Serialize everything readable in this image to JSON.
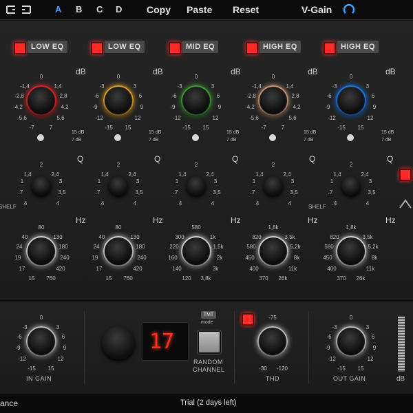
{
  "topbar": {
    "undo_icon": "undo-icon",
    "redo_icon": "redo-icon",
    "slots": [
      "A",
      "B",
      "C",
      "D"
    ],
    "active_slot": "A",
    "copy": "Copy",
    "paste": "Paste",
    "reset": "Reset",
    "vgain": "V-Gain",
    "vgain_icon": "power-icon"
  },
  "bands": [
    {
      "label": "LOW EQ",
      "color": "#e02424"
    },
    {
      "label": "LOW EQ",
      "color": "#e0a020"
    },
    {
      "label": "MID EQ",
      "color": "#3aa030"
    },
    {
      "label": "HIGH EQ",
      "color": "#c89a78"
    },
    {
      "label": "HIGH EQ",
      "color": "#1a78e8"
    }
  ],
  "gain_scales": [
    {
      "unit": "dB",
      "t": "0",
      "l1": "-1,4",
      "r1": "1,4",
      "l2": "-2,8",
      "r2": "2,8",
      "l3": "-4,2",
      "r3": "4,2",
      "l4": "-5,6",
      "r4": "5,6",
      "bl": "-7",
      "br": "7"
    },
    {
      "unit": "dB",
      "t": "0",
      "l1": "-3",
      "r1": "3",
      "l2": "-6",
      "r2": "6",
      "l3": "-9",
      "r3": "9",
      "l4": "-12",
      "r4": "12",
      "bl": "-15",
      "br": "15"
    },
    {
      "unit": "dB",
      "t": "0",
      "l1": "-3",
      "r1": "3",
      "l2": "-6",
      "r2": "6",
      "l3": "-9",
      "r3": "9",
      "l4": "-12",
      "r4": "12",
      "bl": "-15",
      "br": "15"
    },
    {
      "unit": "dB",
      "t": "0",
      "l1": "-1,4",
      "r1": "1,4",
      "l2": "-2,8",
      "r2": "2,8",
      "l3": "-4,2",
      "r3": "4,2",
      "l4": "-5,6",
      "r4": "5,6",
      "bl": "-7",
      "br": "7"
    },
    {
      "unit": "dB",
      "t": "0",
      "l1": "-3",
      "r1": "3",
      "l2": "-6",
      "r2": "6",
      "l3": "-9",
      "r3": "9",
      "l4": "-12",
      "r4": "12",
      "bl": "-15",
      "br": "15"
    }
  ],
  "range_switch": {
    "hi": "15 dB",
    "lo": "7 dB"
  },
  "q_scales": [
    {
      "unit": "Q",
      "t": "2",
      "l1": "1,4",
      "r1": "2,4",
      "l2": "1",
      "r2": "3",
      "l3": ".7",
      "r3": "3,5",
      "l4": ".4",
      "r4": "4",
      "extra": "SHELF"
    },
    {
      "unit": "Q",
      "t": "2",
      "l1": "1,4",
      "r1": "2,4",
      "l2": "1",
      "r2": "3",
      "l3": ".7",
      "r3": "3,5",
      "l4": ".4",
      "r4": "4",
      "extra": ""
    },
    {
      "unit": "Q",
      "t": "2",
      "l1": "1,4",
      "r1": "2,4",
      "l2": "1",
      "r2": "3",
      "l3": ".7",
      "r3": "3,5",
      "l4": ".4",
      "r4": "4",
      "extra": ""
    },
    {
      "unit": "Q",
      "t": "2",
      "l1": "1,4",
      "r1": "2,4",
      "l2": "1",
      "r2": "3",
      "l3": ".7",
      "r3": "3,5",
      "l4": ".4",
      "r4": "4",
      "extra": ""
    },
    {
      "unit": "Q",
      "t": "2",
      "l1": "1,4",
      "r1": "2,4",
      "l2": "1",
      "r2": "3",
      "l3": ".7",
      "r3": "3,5",
      "l4": ".4",
      "r4": "4",
      "extra": "SHELF"
    }
  ],
  "hz_scales": [
    {
      "unit": "Hz",
      "t": "80",
      "l1": "40",
      "r1": "130",
      "l2": "24",
      "r2": "180",
      "l3": "19",
      "r3": "240",
      "l4": "17",
      "r4": "420",
      "bl": "15",
      "br": "760"
    },
    {
      "unit": "Hz",
      "t": "80",
      "l1": "40",
      "r1": "130",
      "l2": "24",
      "r2": "180",
      "l3": "19",
      "r3": "240",
      "l4": "17",
      "r4": "420",
      "bl": "15",
      "br": "760"
    },
    {
      "unit": "Hz",
      "t": "580",
      "l1": "300",
      "r1": "1k",
      "l2": "220",
      "r2": "1,5k",
      "l3": "160",
      "r3": "2k",
      "l4": "140",
      "r4": "3k",
      "bl": "120",
      "br": "3,8k"
    },
    {
      "unit": "Hz",
      "t": "1,8k",
      "l1": "820",
      "r1": "3,5k",
      "l2": "580",
      "r2": "5,2k",
      "l3": "450",
      "r3": "8k",
      "l4": "400",
      "r4": "11k",
      "bl": "370",
      "br": "26k"
    },
    {
      "unit": "Hz",
      "t": "1,8k",
      "l1": "820",
      "r1": "3,5k",
      "l2": "580",
      "r2": "5,2k",
      "l3": "450",
      "r3": "8k",
      "l4": "400",
      "r4": "11k",
      "bl": "370",
      "br": "26k"
    }
  ],
  "in_gain": {
    "label": "IN GAIN",
    "t": "0",
    "l1": "-3",
    "r1": "3",
    "l2": "-6",
    "r2": "6",
    "l3": "-9",
    "r3": "9",
    "l4": "-12",
    "r4": "12",
    "bl": "-15",
    "br": "15"
  },
  "channel": {
    "value": "17",
    "label1": "RANDOM",
    "label2": "CHANNEL",
    "badge": "TMT",
    "badge_sub": "mode"
  },
  "thd": {
    "label": "THD",
    "t": "-75",
    "bl": "-30",
    "br": "-120"
  },
  "out_gain": {
    "label": "OUT GAIN",
    "t": "0",
    "l1": "-3",
    "r1": "3",
    "l2": "-6",
    "r2": "6",
    "l3": "-9",
    "r3": "9",
    "l4": "-12",
    "r4": "12",
    "bl": "-15",
    "br": "15"
  },
  "meter_unit": "dB",
  "status": {
    "left": "ance",
    "center": "Trial (2 days left)"
  }
}
